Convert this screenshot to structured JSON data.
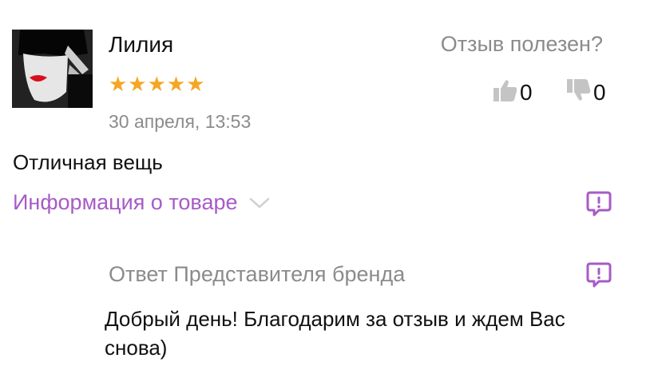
{
  "review": {
    "author": "Лилия",
    "stars": "★★★★★",
    "date": "30 апреля, 13:53",
    "text": "Отличная вещь",
    "product_info_label": "Информация о товаре"
  },
  "helpful": {
    "question": "Отзыв полезен?",
    "likes": "0",
    "dislikes": "0"
  },
  "reply": {
    "title": "Ответ Представителя бренда",
    "text": "Добрый день! Благодарим за отзыв и ждем Вас снова)"
  },
  "icons": {
    "thumbs_up": "thumbs-up-icon",
    "thumbs_down": "thumbs-down-icon",
    "report": "report-icon",
    "chevron": "chevron-down-icon"
  },
  "colors": {
    "accent": "#a75bc6",
    "star": "#f5a623",
    "muted": "#8b8b8b",
    "icon_gray": "#c4c4c4"
  },
  "ratings": {
    "stars": 5,
    "max": 5
  }
}
